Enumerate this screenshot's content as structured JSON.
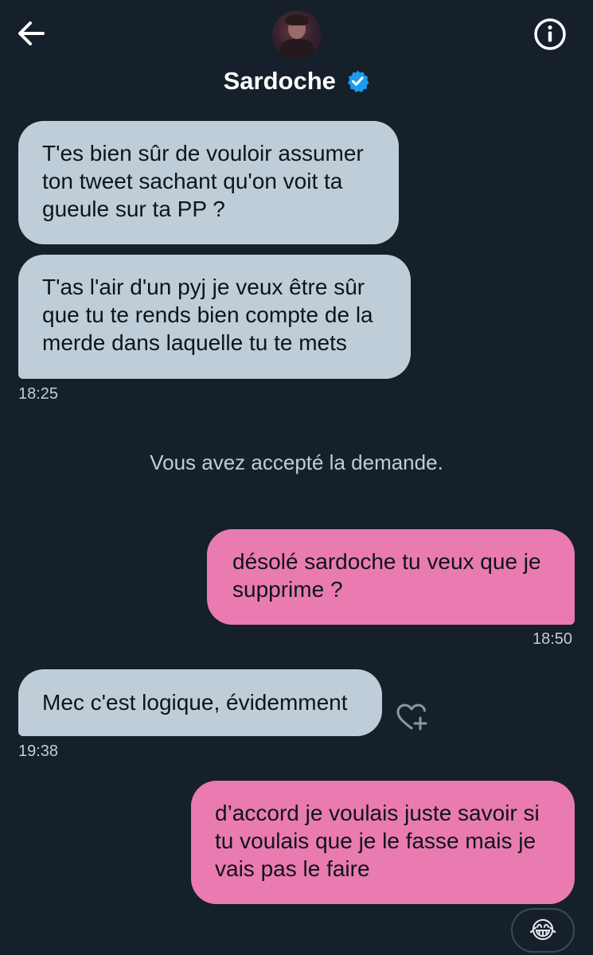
{
  "header": {
    "name": "Sardoche",
    "icons": {
      "back": "arrow-left-icon",
      "info": "info-icon",
      "verified": "verified-badge-icon"
    },
    "verified_color": "#1d9bf0"
  },
  "messages": [
    {
      "side": "incoming",
      "text": "T'es bien sûr de vouloir assumer ton tweet sachant qu'on voit ta gueule sur ta PP ?"
    },
    {
      "side": "incoming",
      "text": "T'as l'air d'un pyj je veux être sûr que tu te rends bien compte de la merde dans laquelle tu te mets",
      "time": "18:25"
    },
    {
      "side": "outgoing",
      "text": "désolé sardoche tu veux que je supprime ?",
      "time": "18:50"
    },
    {
      "side": "incoming",
      "text": "Mec c'est logique, évidemment",
      "time": "19:38",
      "action_icon": "heart-plus-icon"
    },
    {
      "side": "outgoing",
      "text": "d’accord je voulais juste savoir si tu voulais que je le fasse mais je vais pas le faire",
      "reaction": "😂"
    }
  ],
  "system_message": "Vous avez accepté la demande.",
  "colors": {
    "background": "#15202b",
    "incoming_bubble": "#bfcdd8",
    "outgoing_bubble": "#ea7bb0"
  }
}
